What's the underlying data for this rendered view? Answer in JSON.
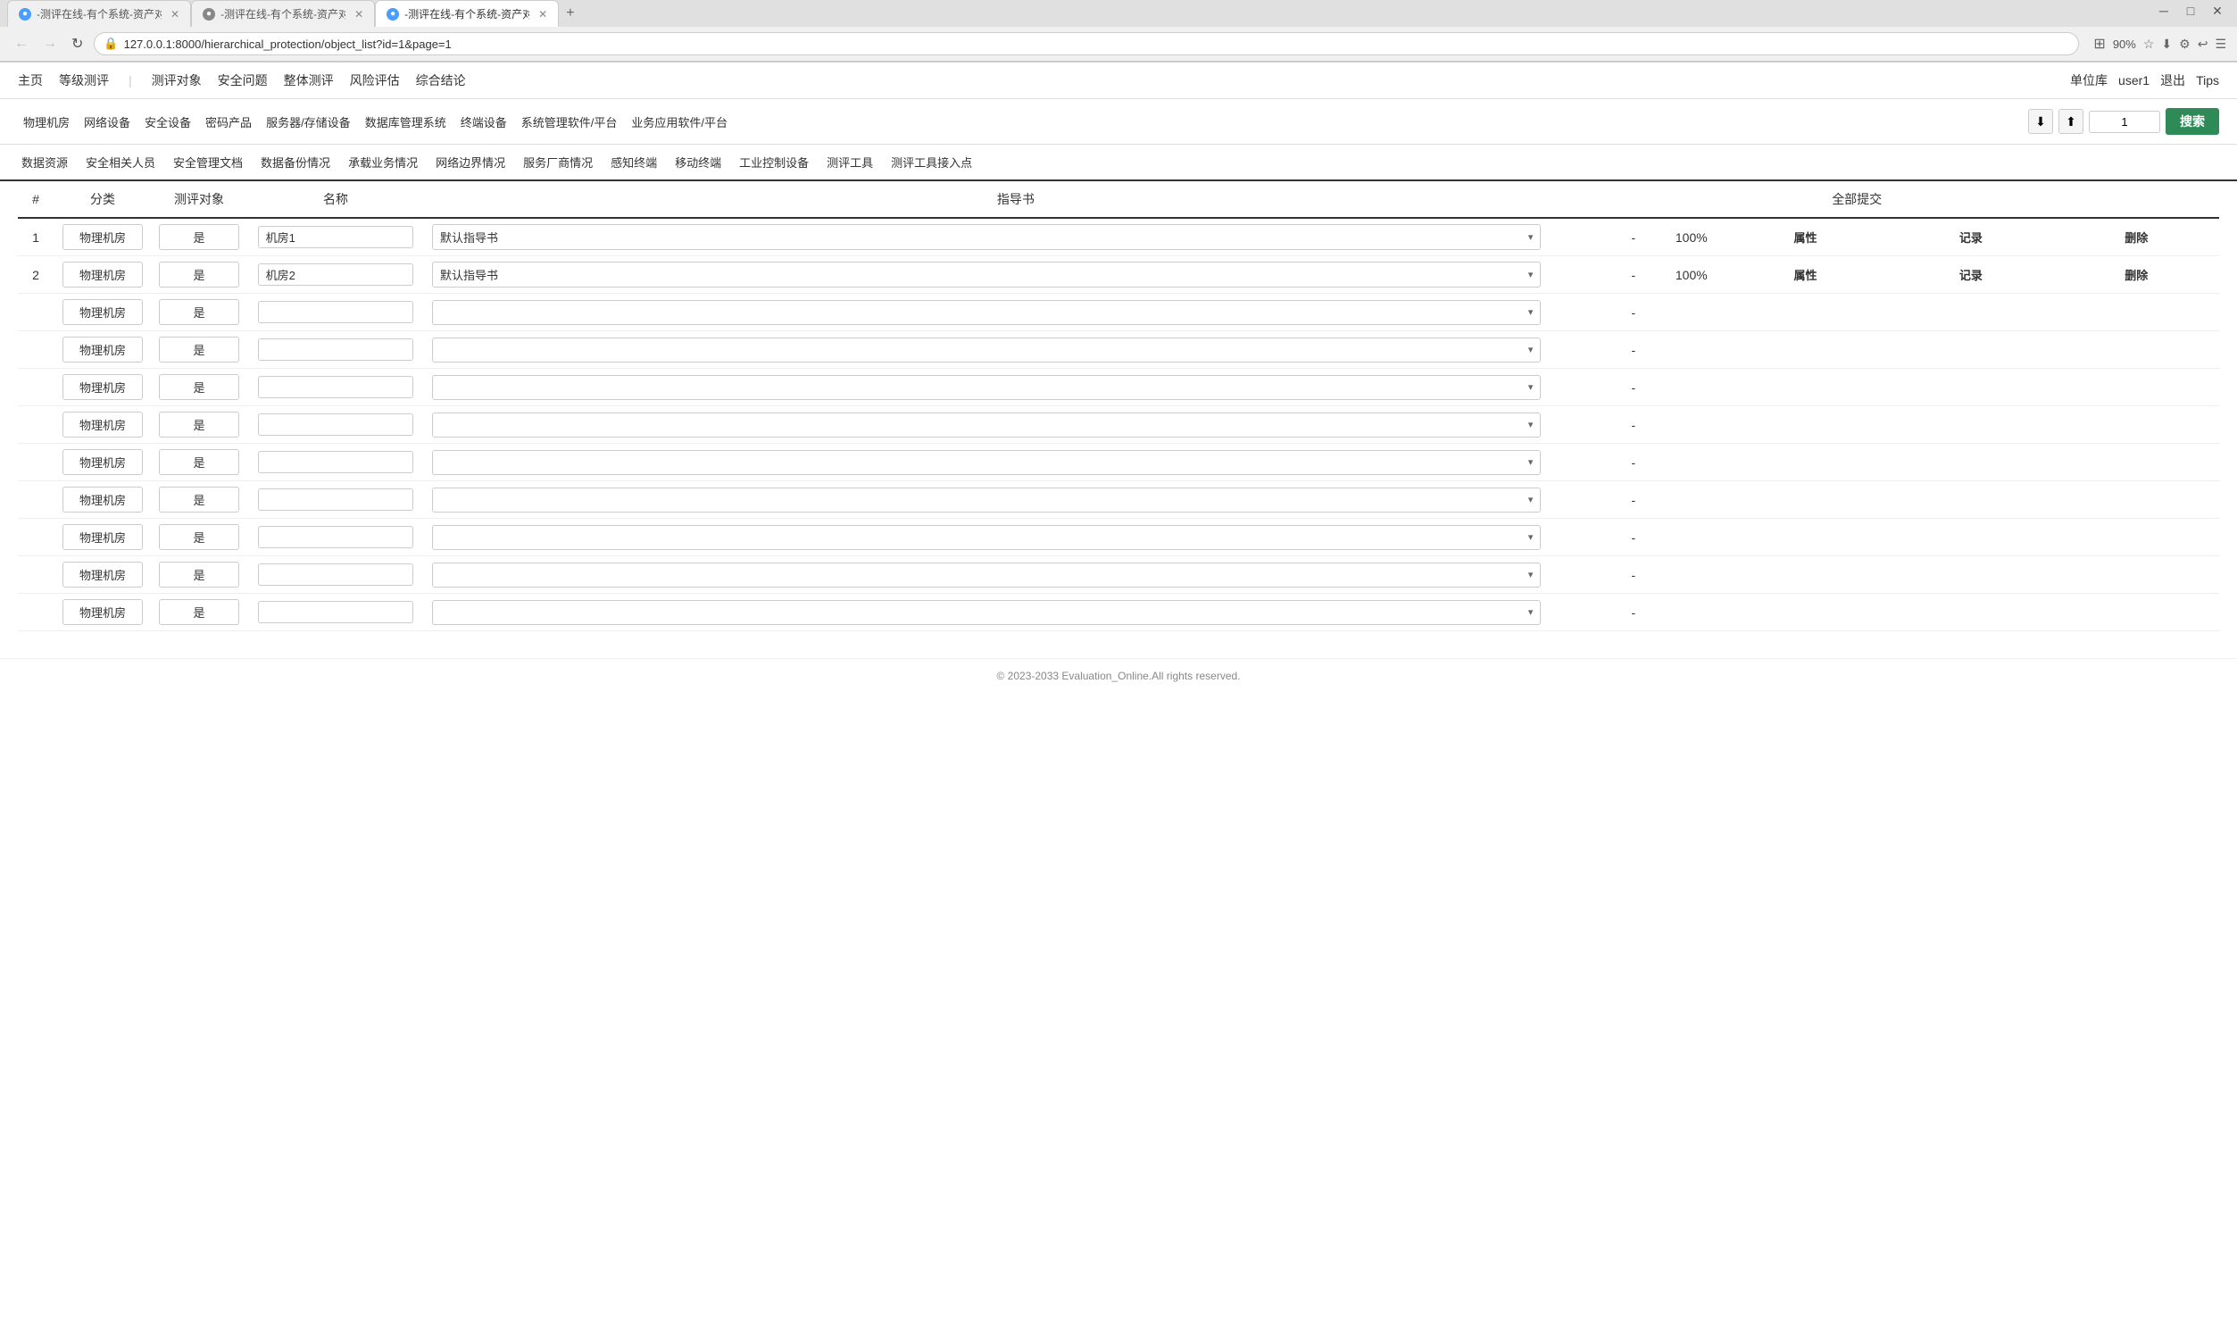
{
  "browser": {
    "tabs": [
      {
        "id": 1,
        "label": "-测评在线-有个系统-资产对象",
        "active": false,
        "icon": "blue"
      },
      {
        "id": 2,
        "label": "-测评在线-有个系统-资产对象",
        "active": false,
        "icon": "gray"
      },
      {
        "id": 3,
        "label": "-测评在线-有个系统-资产对象",
        "active": true,
        "icon": "blue"
      }
    ],
    "address": "127.0.0.1:8000/hierarchical_protection/object_list?id=1&page=1",
    "zoom": "90%"
  },
  "app_nav": {
    "links": [
      "主页",
      "等级测评",
      "测评对象",
      "安全问题",
      "整体测评",
      "风险评估",
      "综合结论"
    ],
    "right_links": [
      "单位库",
      "user1",
      "退出",
      "Tips"
    ]
  },
  "cat_nav": {
    "items": [
      "物理机房",
      "网络设备",
      "安全设备",
      "密码产品",
      "服务器/存储设备",
      "数据库管理系统",
      "终端设备",
      "系统管理软件/平台",
      "业务应用软件/平台"
    ],
    "search_value": "1",
    "search_btn": "搜索"
  },
  "subcat_nav": {
    "items": [
      "数据资源",
      "安全相关人员",
      "安全管理文档",
      "数据备份情况",
      "承载业务情况",
      "网络边界情况",
      "服务厂商情况",
      "感知终端",
      "移动终端",
      "工业控制设备",
      "测评工具",
      "测评工具接入点"
    ]
  },
  "table": {
    "headers": [
      "#",
      "分类",
      "测评对象",
      "名称",
      "指导书",
      "",
      "",
      "全部提交"
    ],
    "col_headers_row2": [
      "",
      "",
      "",
      "",
      "",
      "",
      "",
      "属性",
      "记录",
      "删除"
    ],
    "rows": [
      {
        "num": "1",
        "cat": "物理机房",
        "obj": "是",
        "name": "机房1",
        "guide": "默认指导书",
        "score": "-",
        "pct": "100%",
        "show_actions": true
      },
      {
        "num": "2",
        "cat": "物理机房",
        "obj": "是",
        "name": "机房2",
        "guide": "默认指导书",
        "score": "-",
        "pct": "100%",
        "show_actions": true
      },
      {
        "num": "",
        "cat": "物理机房",
        "obj": "是",
        "name": "",
        "guide": "",
        "score": "-",
        "pct": "",
        "show_actions": false
      },
      {
        "num": "",
        "cat": "物理机房",
        "obj": "是",
        "name": "",
        "guide": "",
        "score": "-",
        "pct": "",
        "show_actions": false
      },
      {
        "num": "",
        "cat": "物理机房",
        "obj": "是",
        "name": "",
        "guide": "",
        "score": "-",
        "pct": "",
        "show_actions": false
      },
      {
        "num": "",
        "cat": "物理机房",
        "obj": "是",
        "name": "",
        "guide": "",
        "score": "-",
        "pct": "",
        "show_actions": false
      },
      {
        "num": "",
        "cat": "物理机房",
        "obj": "是",
        "name": "",
        "guide": "",
        "score": "-",
        "pct": "",
        "show_actions": false
      },
      {
        "num": "",
        "cat": "物理机房",
        "obj": "是",
        "name": "",
        "guide": "",
        "score": "-",
        "pct": "",
        "show_actions": false
      },
      {
        "num": "",
        "cat": "物理机房",
        "obj": "是",
        "name": "",
        "guide": "",
        "score": "-",
        "pct": "",
        "show_actions": false
      },
      {
        "num": "",
        "cat": "物理机房",
        "obj": "是",
        "name": "",
        "guide": "",
        "score": "-",
        "pct": "",
        "show_actions": false
      },
      {
        "num": "",
        "cat": "物理机房",
        "obj": "是",
        "name": "",
        "guide": "",
        "score": "-",
        "pct": "",
        "show_actions": false
      }
    ],
    "actions": {
      "attr": "属性",
      "record": "记录",
      "delete": "删除"
    }
  },
  "footer": {
    "text": "© 2023-2033 Evaluation_Online.All rights reserved."
  },
  "icons": {
    "download": "⬇",
    "upload": "⬆",
    "lock": "🔒",
    "star": "☆",
    "extensions": "⚙",
    "arrow_down": "⌄"
  }
}
